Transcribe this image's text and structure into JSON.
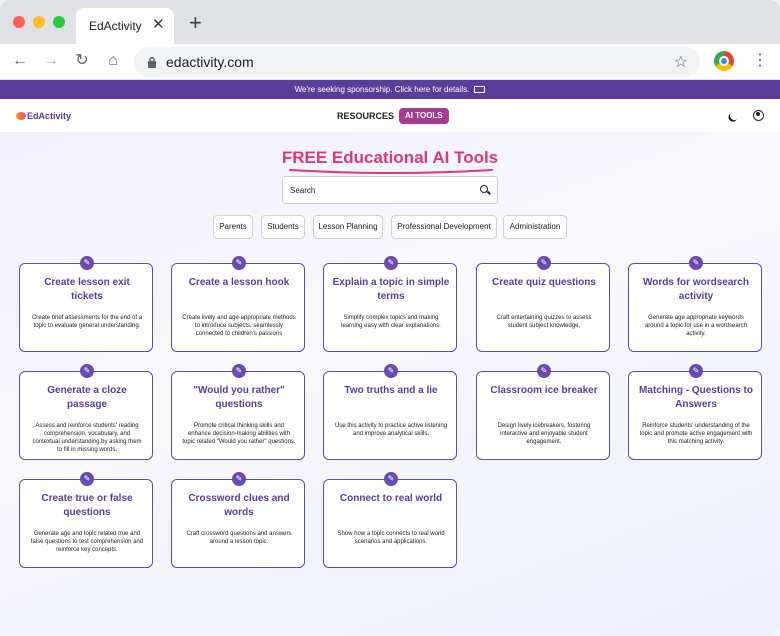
{
  "browser": {
    "tab_title": "EdActivity",
    "tab_close": "✕",
    "new_tab": "+",
    "url": "edactivity.com",
    "back": "←",
    "forward": "→",
    "reload": "↻",
    "home": "⌂",
    "star": "☆",
    "menu": "⋮"
  },
  "banner": {
    "text": "We're seeking sponsorship. Click here for details."
  },
  "header": {
    "logo": "EdActivity",
    "nav_resources": "RESOURCES",
    "nav_ai_tools": "AI TOOLS"
  },
  "main": {
    "title": "FREE Educational AI Tools",
    "search_value": "Search",
    "filters": [
      "Parents",
      "Students",
      "Lesson Planning",
      "Professional Development",
      "Administration"
    ],
    "cards": [
      {
        "title": "Create lesson exit tickets",
        "desc": "Create brief assessments for the end of a topic to evaluate general understanding."
      },
      {
        "title": "Create a lesson hook",
        "desc": "Create lively and age-appropriate methods to introduce subjects, seamlessly connected to children's passions"
      },
      {
        "title": "Explain a topic in simple terms",
        "desc": "Simplify complex topics and making learning easy with clear explanations."
      },
      {
        "title": "Create quiz questions",
        "desc": "Craft entertaining quizzes to assess student subject knowledge."
      },
      {
        "title": "Words for wordsearch activity",
        "desc": "Generate age appropriate keywords around a topic for use in a wordsearch activity."
      },
      {
        "title": "Generate a cloze passage",
        "desc": "Assess and reinforce students' reading comprehension, vocabulary, and contextual understanding by asking them to fill in missing words."
      },
      {
        "title": "\"Would you rather\" questions",
        "desc": "Promote critical thinking skills and enhance decision-making abilities with topic related \"Would you rather\" questions."
      },
      {
        "title": "Two truths and a lie",
        "desc": "Use this activity to practice active listening and improve analytical skills."
      },
      {
        "title": "Classroom ice breaker",
        "desc": "Design lively icebreakers, fostering interactive and enjoyable student engagement."
      },
      {
        "title": "Matching - Questions to Answers",
        "desc": "Reinforce students' understanding of the topic and promote active engagement with this matching activity."
      },
      {
        "title": "Create true or false questions",
        "desc": "Generate age and topic related true and false questions to test comprehension and reinforce key concepts."
      },
      {
        "title": "Crossword clues and words",
        "desc": "Craft crossword questions and answers around a lesson topic."
      },
      {
        "title": "Connect to real world",
        "desc": "Show how a topic connects to real world scenarios and applications."
      }
    ]
  },
  "colors": {
    "brand": "#5a3d9a",
    "accent": "#d93a7e",
    "ai_tools": "#a83a8f"
  }
}
